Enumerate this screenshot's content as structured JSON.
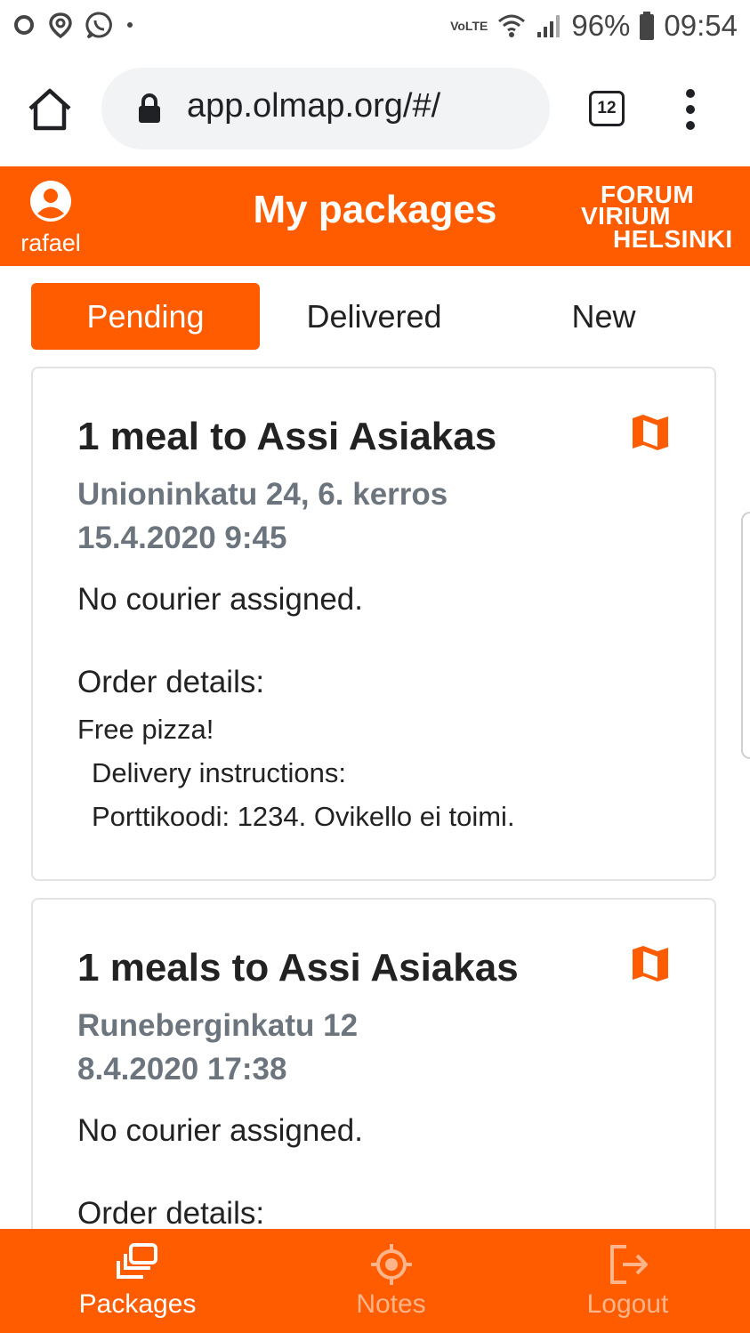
{
  "status_bar": {
    "network_label": "VoLTE",
    "battery": "96%",
    "time": "09:54"
  },
  "browser": {
    "url": "app.olmap.org/#/",
    "tab_count": "12"
  },
  "header": {
    "user_name": "rafael",
    "title": "My packages",
    "logo_lines": [
      "FORUM",
      "VIRIUM",
      "HELSINKI"
    ]
  },
  "tabs": [
    {
      "label": "Pending",
      "active": true
    },
    {
      "label": "Delivered",
      "active": false
    },
    {
      "label": "New",
      "active": false
    }
  ],
  "packages": [
    {
      "title": "1 meal to Assi Asiakas",
      "address": "Unioninkatu 24, 6. kerros",
      "date": "15.4.2020 9:45",
      "courier": "No courier assigned.",
      "details_label": "Order details:",
      "item": "Free pizza!",
      "instructions_label": "Delivery instructions:",
      "instructions": "Porttikoodi: 1234. Ovikello ei toimi."
    },
    {
      "title": "1 meals to Assi Asiakas",
      "address": "Runeberginkatu 12",
      "date": "8.4.2020 17:38",
      "courier": "No courier assigned.",
      "details_label": "Order details:"
    }
  ],
  "bottom_nav": [
    {
      "label": "Packages",
      "icon": "packages-icon",
      "active": true
    },
    {
      "label": "Notes",
      "icon": "target-icon",
      "active": false
    },
    {
      "label": "Logout",
      "icon": "logout-icon",
      "active": false
    }
  ],
  "colors": {
    "accent": "#ff5c00",
    "muted_text": "#6c757d"
  }
}
